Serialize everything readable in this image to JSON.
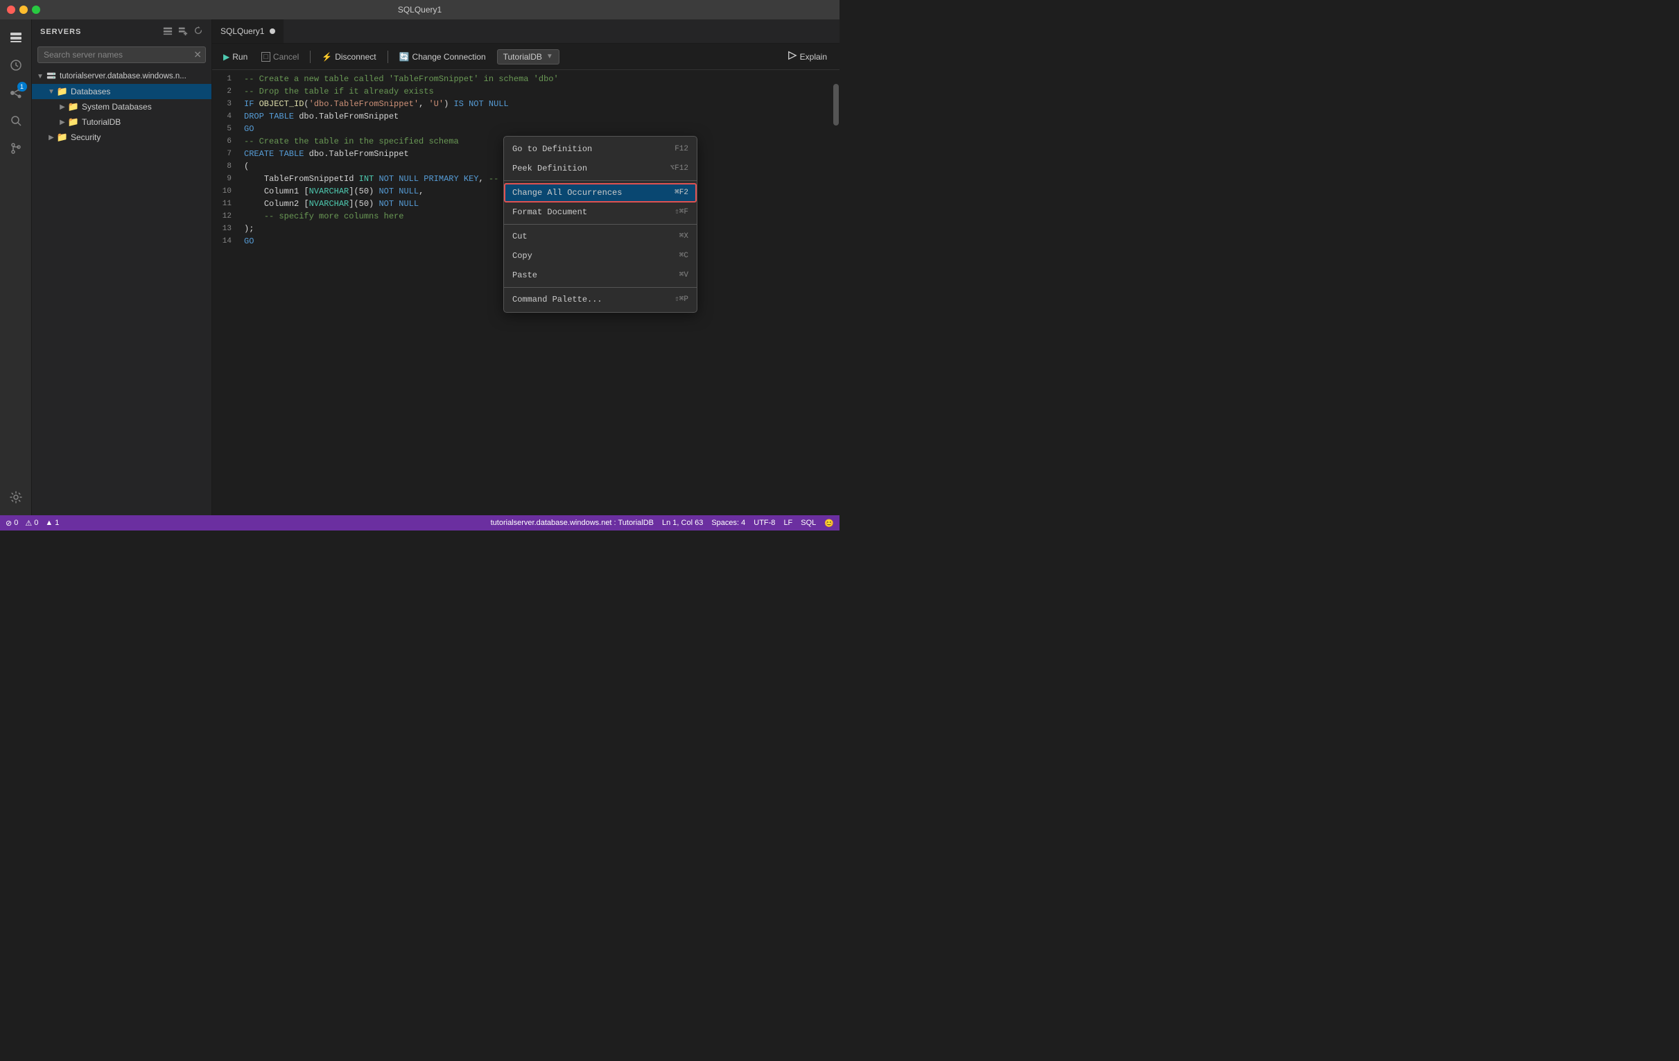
{
  "titlebar": {
    "title": "SQLQuery1"
  },
  "activity_bar": {
    "icons": [
      {
        "name": "servers-icon",
        "symbol": "⊞",
        "active": true
      },
      {
        "name": "clock-icon",
        "symbol": "🕐",
        "active": false
      },
      {
        "name": "database-icon",
        "symbol": "🗄",
        "active": false,
        "badge": "1"
      },
      {
        "name": "search-icon",
        "symbol": "🔍",
        "active": false
      },
      {
        "name": "git-icon",
        "symbol": "⎇",
        "active": false
      }
    ],
    "bottom_icons": [
      {
        "name": "settings-icon",
        "symbol": "⚙"
      }
    ]
  },
  "sidebar": {
    "header": "SERVERS",
    "search_placeholder": "Search server names",
    "tree": [
      {
        "id": "server",
        "label": "tutorialserver.database.windows.n...",
        "level": 0,
        "expanded": true,
        "icon": "server",
        "children": [
          {
            "id": "databases",
            "label": "Databases",
            "level": 1,
            "expanded": true,
            "icon": "folder",
            "children": [
              {
                "id": "system-databases",
                "label": "System Databases",
                "level": 2,
                "expanded": false,
                "icon": "folder"
              },
              {
                "id": "tutorialdb",
                "label": "TutorialDB",
                "level": 2,
                "expanded": false,
                "icon": "folder"
              }
            ]
          },
          {
            "id": "security",
            "label": "Security",
            "level": 1,
            "expanded": false,
            "icon": "folder"
          }
        ]
      }
    ]
  },
  "editor": {
    "tab_label": "SQLQuery1",
    "tab_modified": true
  },
  "toolbar": {
    "run_label": "Run",
    "cancel_label": "Cancel",
    "disconnect_label": "Disconnect",
    "change_connection_label": "Change Connection",
    "database_name": "TutorialDB",
    "explain_label": "Explain"
  },
  "code": {
    "lines": [
      {
        "num": 1,
        "content": "-- Create a new table called 'TableFromSnippet' in schema 'dbo'",
        "type": "comment"
      },
      {
        "num": 2,
        "content": "-- Drop the table if it already exists",
        "type": "comment"
      },
      {
        "num": 3,
        "content": "IF OBJECT_ID('dbo.TableFromSnippet', 'U') IS NOT NULL",
        "type": "mixed"
      },
      {
        "num": 4,
        "content": "DROP TABLE dbo.TableFromSnippet",
        "type": "mixed"
      },
      {
        "num": 5,
        "content": "GO",
        "type": "keyword"
      },
      {
        "num": 6,
        "content": "-- Create the table in the specified schema",
        "type": "comment"
      },
      {
        "num": 7,
        "content": "CREATE TABLE dbo.TableFromSnippet",
        "type": "mixed"
      },
      {
        "num": 8,
        "content": "(",
        "type": "plain"
      },
      {
        "num": 9,
        "content": "    TableFromSnippetId INT NOT NULL PRIMARY KEY, -- primary key",
        "type": "mixed"
      },
      {
        "num": 10,
        "content": "    Column1 [NVARCHAR](50) NOT NULL,",
        "type": "mixed"
      },
      {
        "num": 11,
        "content": "    Column2 [NVARCHAR](50) NOT NULL",
        "type": "mixed"
      },
      {
        "num": 12,
        "content": "    -- specify more columns here",
        "type": "comment"
      },
      {
        "num": 13,
        "content": ");",
        "type": "plain"
      },
      {
        "num": 14,
        "content": "GO",
        "type": "keyword"
      }
    ]
  },
  "context_menu": {
    "items": [
      {
        "label": "Go to Definition",
        "shortcut": "F12",
        "separator_after": false
      },
      {
        "label": "Peek Definition",
        "shortcut": "⌥F12",
        "separator_after": true
      },
      {
        "label": "Change All Occurrences",
        "shortcut": "⌘F2",
        "highlighted": true,
        "separator_after": false
      },
      {
        "label": "Format Document",
        "shortcut": "⇧⌘F",
        "separator_after": true
      },
      {
        "label": "Cut",
        "shortcut": "⌘X",
        "separator_after": false
      },
      {
        "label": "Copy",
        "shortcut": "⌘C",
        "separator_after": false
      },
      {
        "label": "Paste",
        "shortcut": "⌘V",
        "separator_after": true
      },
      {
        "label": "Command Palette...",
        "shortcut": "⇧⌘P",
        "separator_after": false
      }
    ]
  },
  "status_bar": {
    "left": [
      {
        "name": "errors",
        "icon": "⊘",
        "value": "0"
      },
      {
        "name": "warnings",
        "icon": "⚠",
        "value": "0"
      },
      {
        "name": "info",
        "icon": "▲",
        "value": "1"
      }
    ],
    "connection": "tutorialserver.database.windows.net : TutorialDB",
    "position": "Ln 1, Col 63",
    "spaces": "Spaces: 4",
    "encoding": "UTF-8",
    "line_ending": "LF",
    "language": "SQL",
    "feedback_icon": "😊"
  }
}
